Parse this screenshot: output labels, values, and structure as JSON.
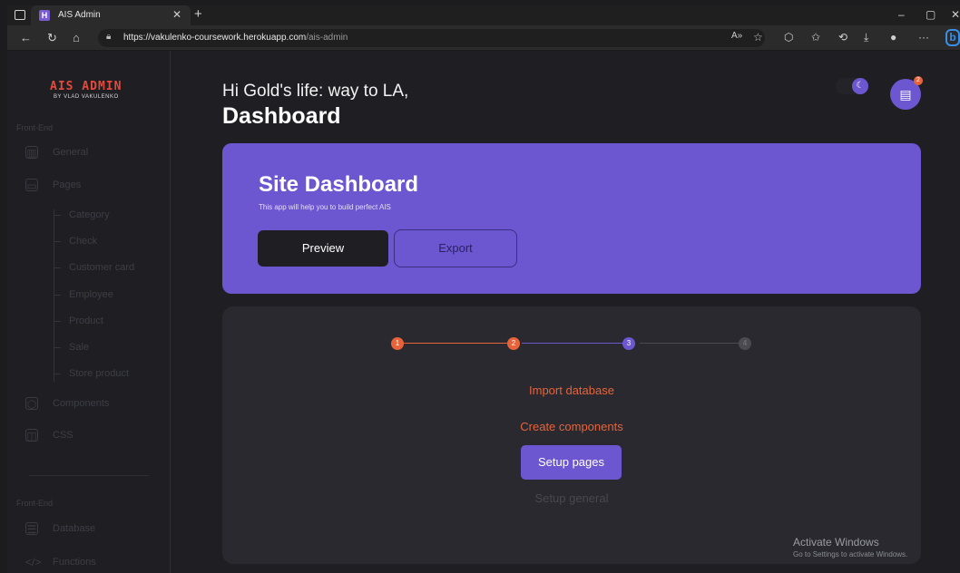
{
  "browser": {
    "tab_title": "AIS Admin",
    "tab_favicon_letter": "H",
    "url_domain": "https://vakulenko-coursework.herokuapp.com",
    "url_path": "/ais-admin"
  },
  "sidebar": {
    "logo": "AIS ADMIN",
    "logo_sub": "BY VLAD VAKULENKO",
    "section1": "Front-End",
    "items": [
      {
        "label": "General",
        "icon": "chart-icon"
      },
      {
        "label": "Pages",
        "icon": "pages-icon"
      }
    ],
    "sub_items": [
      "Category",
      "Check",
      "Customer card",
      "Employee",
      "Product",
      "Sale",
      "Store product"
    ],
    "items2": [
      {
        "label": "Components",
        "icon": "components-icon"
      },
      {
        "label": "CSS",
        "icon": "css-icon"
      }
    ],
    "section2": "Front-End",
    "items3": [
      {
        "label": "Database",
        "icon": "database-icon"
      },
      {
        "label": "Functions",
        "icon": "code-icon"
      }
    ]
  },
  "header": {
    "greeting": "Hi Gold's life: way to LA,",
    "title": "Dashboard",
    "notification_count": "2"
  },
  "hero": {
    "title": "Site Dashboard",
    "subtitle": "This app will help you to build perfect AIS",
    "preview_label": "Preview",
    "export_label": "Export"
  },
  "stepper": {
    "steps": [
      "1",
      "2",
      "3",
      "4"
    ],
    "items": [
      "Import database",
      "Create components",
      "Setup pages",
      "Setup general"
    ],
    "colors": {
      "done": "#e8633a",
      "active": "#6c57d1",
      "pending": "#4a4a50"
    }
  },
  "watermark": {
    "title": "Activate Windows",
    "subtitle": "Go to Settings to activate Windows."
  },
  "colors": {
    "accent": "#6c57d1",
    "orange": "#e8633a",
    "background": "#1f1f23",
    "card": "#29292f"
  }
}
